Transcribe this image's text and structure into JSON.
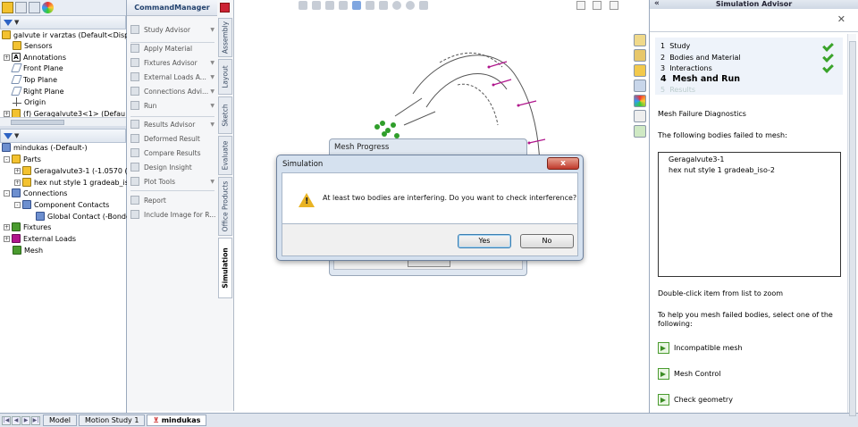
{
  "feature_tree": {
    "top_items": [
      {
        "label": "galvute ir varztas  (Default<Disp",
        "icon": "assembly-icon"
      },
      {
        "label": "Sensors",
        "icon": "sensors-icon"
      },
      {
        "label": "Annotations",
        "icon": "annotations-icon"
      },
      {
        "label": "Front Plane",
        "icon": "plane-icon"
      },
      {
        "label": "Top Plane",
        "icon": "plane-icon"
      },
      {
        "label": "Right Plane",
        "icon": "plane-icon"
      },
      {
        "label": "Origin",
        "icon": "origin-icon"
      },
      {
        "label": "(f) Geragalvute3<1> (Defau",
        "icon": "part-icon"
      }
    ],
    "annotations_icon_letter": "A",
    "bottom_items": [
      {
        "label": "mindukas (-Default-)",
        "icon": "study-icon"
      },
      {
        "label": "Parts",
        "icon": "parts-icon"
      },
      {
        "label": "Geragalvute3-1 (-1.0570 (S3",
        "icon": "part-icon"
      },
      {
        "label": "hex nut style 1 gradeab_iso-",
        "icon": "part-icon"
      },
      {
        "label": "Connections",
        "icon": "connections-icon"
      },
      {
        "label": "Component Contacts",
        "icon": "contacts-icon"
      },
      {
        "label": "Global Contact (-Bonde",
        "icon": "contact-icon"
      },
      {
        "label": "Fixtures",
        "icon": "fixtures-icon"
      },
      {
        "label": "External Loads",
        "icon": "loads-icon"
      },
      {
        "label": "Mesh",
        "icon": "mesh-icon"
      }
    ]
  },
  "bottom_tabs": [
    "Model",
    "Motion Study 1",
    "mindukas"
  ],
  "command_manager": {
    "title": "CommandManager",
    "items": [
      {
        "label": "Study Advisor",
        "arrow": true
      },
      {
        "label": "Apply Material",
        "arrow": false
      },
      {
        "label": "Fixtures Advisor",
        "arrow": true
      },
      {
        "label": "External Loads A...",
        "arrow": true
      },
      {
        "label": "Connections Advi...",
        "arrow": true
      },
      {
        "label": "Run",
        "arrow": true
      },
      {
        "label": "Results Advisor",
        "arrow": true
      },
      {
        "label": "Deformed Result",
        "arrow": false
      },
      {
        "label": "Compare Results",
        "arrow": false
      },
      {
        "label": "Design Insight",
        "arrow": false
      },
      {
        "label": "Plot Tools",
        "arrow": true
      },
      {
        "label": "Report",
        "arrow": false
      },
      {
        "label": "Include Image for R...",
        "arrow": false
      }
    ],
    "vertical_tabs": [
      "Assembly",
      "Layout",
      "Sketch",
      "Evaluate",
      "Office Products",
      "Simulation"
    ]
  },
  "advisor": {
    "title": "Simulation Advisor",
    "steps": [
      {
        "num": "1",
        "label": "Study",
        "done": true
      },
      {
        "num": "2",
        "label": "Bodies and Material",
        "done": true
      },
      {
        "num": "3",
        "label": "Interactions",
        "done": true
      },
      {
        "num": "4",
        "label": "Mesh and Run",
        "done": false
      },
      {
        "num": "5",
        "label": "Results",
        "done": false
      }
    ],
    "diagnostics_title": "Mesh Failure Diagnostics",
    "failed_intro": "The following bodies failed to mesh:",
    "failed_bodies": [
      "Geragalvute3-1",
      "hex nut style 1 gradeab_iso-2"
    ],
    "zoom_hint": "Double-click item from list to zoom",
    "help_line1": "To help you mesh failed bodies, select one of the",
    "help_line2": "following:",
    "links": [
      "Incompatible mesh",
      "Mesh Control",
      "Check geometry"
    ]
  },
  "mesh_progress": {
    "title": "Mesh Progress"
  },
  "dialog": {
    "title": "Simulation",
    "close": "x",
    "message": "At least two bodies are interfering. Do you want to check interference?",
    "yes": "Yes",
    "no": "No"
  },
  "colors": {
    "accent": "#2d63c4",
    "check": "#3aa32a",
    "load_arrows": "#b0168c",
    "fixture": "#2f9e2a"
  }
}
